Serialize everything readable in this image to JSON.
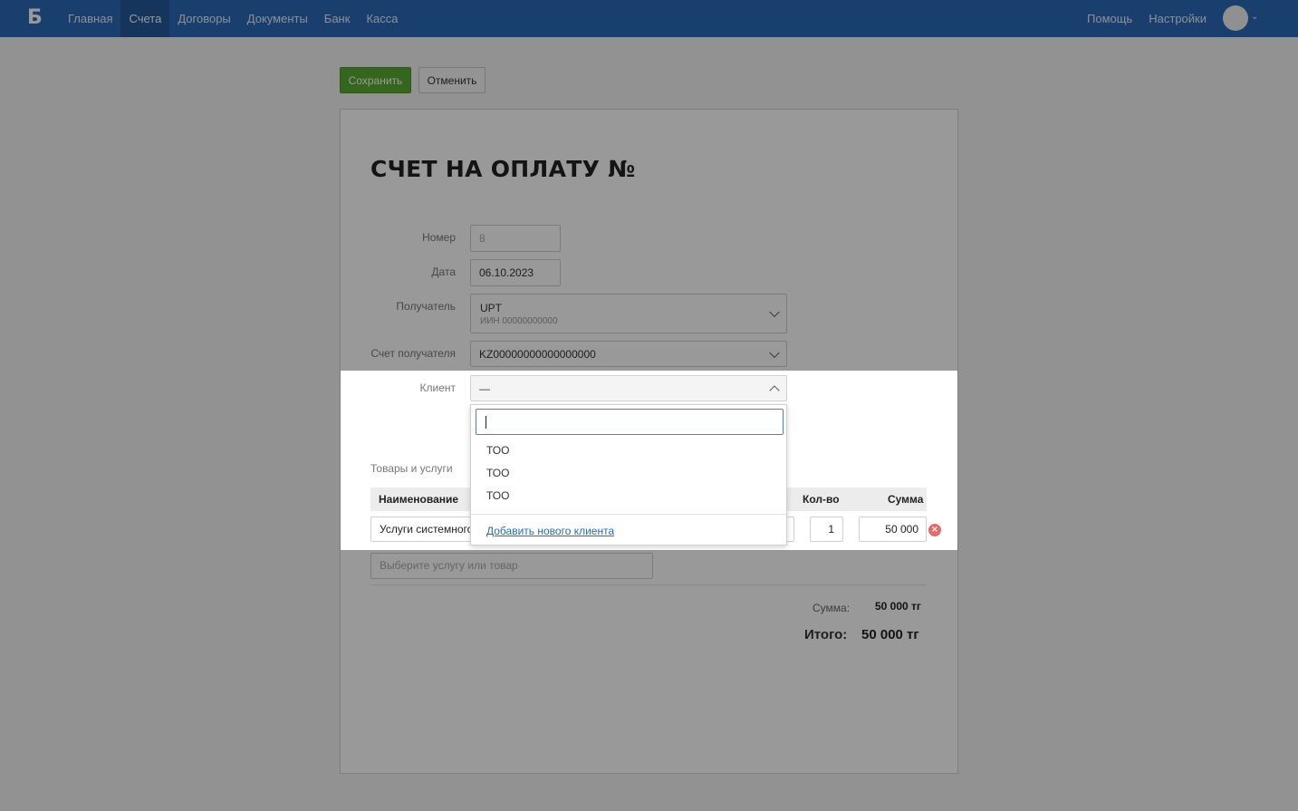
{
  "nav": {
    "logo": "Б",
    "items": [
      {
        "label": "Главная",
        "active": false
      },
      {
        "label": "Счета",
        "active": true
      },
      {
        "label": "Договоры",
        "active": false
      },
      {
        "label": "Документы",
        "active": false
      },
      {
        "label": "Банк",
        "active": false
      },
      {
        "label": "Касса",
        "active": false
      }
    ],
    "right": [
      {
        "label": "Помощь"
      },
      {
        "label": "Настройки"
      }
    ]
  },
  "toolbar": {
    "save_label": "Сохранить",
    "cancel_label": "Отменить"
  },
  "document": {
    "title": "СЧЕТ НА ОПЛАТУ №"
  },
  "form": {
    "number": {
      "label": "Номер",
      "value": "8"
    },
    "date": {
      "label": "Дата",
      "value": "06.10.2023"
    },
    "recipient": {
      "label": "Получатель",
      "name": "UPT",
      "iin": "ИИН 00000000000"
    },
    "account": {
      "label": "Счет получателя",
      "value": "KZ00000000000000000"
    },
    "client": {
      "label": "Клиент",
      "value": "—"
    }
  },
  "dropdown": {
    "search_value": "",
    "options": [
      "ТОО",
      "ТОО",
      "ТОО"
    ],
    "add_link": "Добавить нового клиента"
  },
  "items": {
    "section_label": "Товары и услуги",
    "columns": {
      "name": "Наименование",
      "qty": "Кол-во",
      "sum": "Сумма"
    },
    "rows": [
      {
        "name": "Услуги системного",
        "qty": "1",
        "sum": "50 000"
      }
    ],
    "add_placeholder": "Выберите услугу или товар"
  },
  "totals": {
    "sum_label": "Сумма:",
    "sum_value": "50 000 тг",
    "total_label": "Итого:",
    "total_value": "50 000 тг"
  },
  "colors": {
    "brand": "#2a6ab8",
    "save_button": "#5aab32",
    "remove_icon": "#e96a6a",
    "focus_border": "#3a86d8"
  }
}
